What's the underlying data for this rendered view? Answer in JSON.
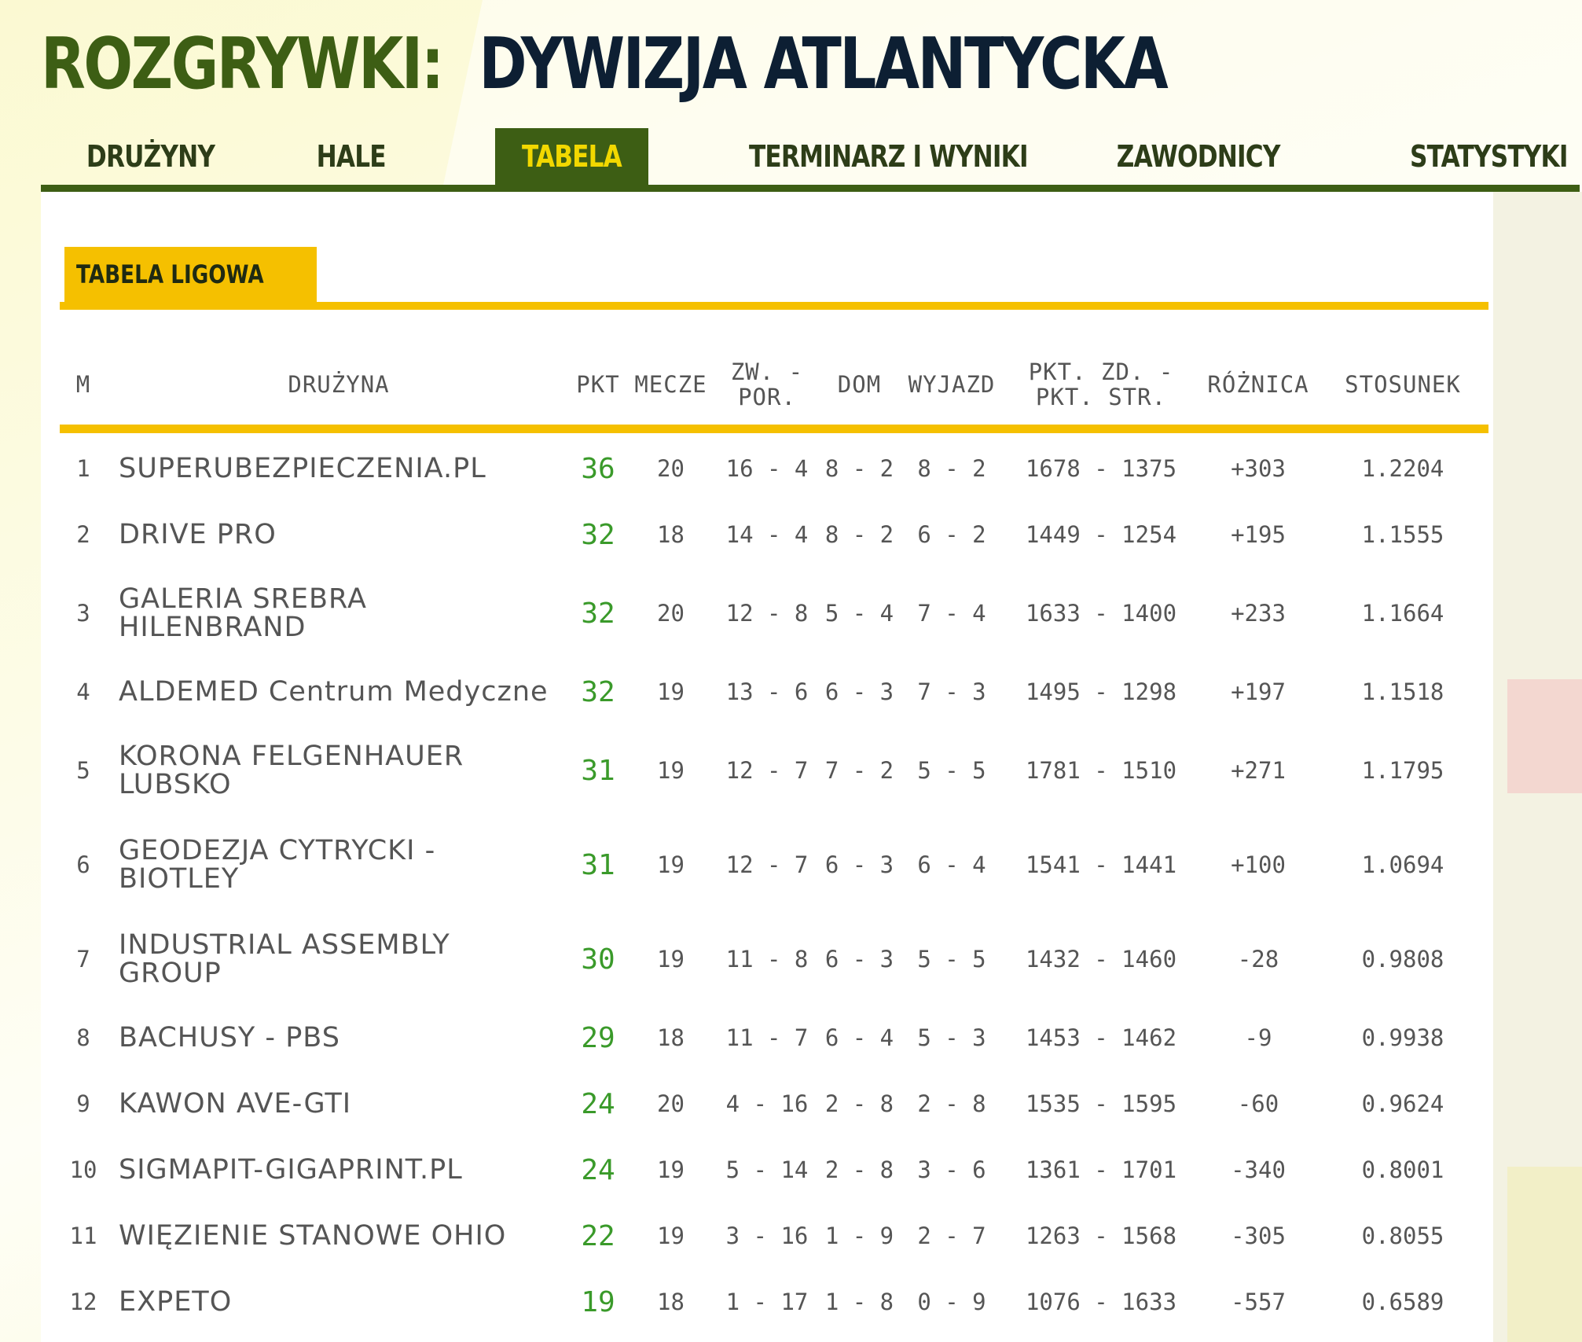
{
  "title": {
    "prefix": "ROZGRYWKI:",
    "main": "DYWIZJA ATLANTYCKA"
  },
  "tabs": [
    {
      "label": "DRUŻYNY"
    },
    {
      "label": "HALE"
    },
    {
      "label": "TABELA",
      "active": true
    },
    {
      "label": "TERMINARZ I WYNIKI"
    },
    {
      "label": "ZAWODNICY"
    },
    {
      "label": "STATYSTYKI"
    }
  ],
  "section": {
    "label": "TABELA LIGOWA"
  },
  "table": {
    "headers": {
      "pos": "M",
      "team": "DRUŻYNA",
      "pts": "PKT",
      "games": "MECZE",
      "wl": "ZW. - POR.",
      "home": "DOM",
      "away": "WYJAZD",
      "points_for_against": "PKT. ZD. - PKT. STR.",
      "diff": "RÓŻNICA",
      "ratio": "STOSUNEK"
    },
    "rows": [
      {
        "pos": "1",
        "team": "SUPERUBEZPIECZENIA.PL",
        "pts": "36",
        "games": "20",
        "wl": "16 - 4",
        "home": "8 - 2",
        "away": "8 - 2",
        "pfpa": "1678 - 1375",
        "diff": "+303",
        "ratio": "1.2204"
      },
      {
        "pos": "2",
        "team": "DRIVE PRO",
        "pts": "32",
        "games": "18",
        "wl": "14 - 4",
        "home": "8 - 2",
        "away": "6 - 2",
        "pfpa": "1449 - 1254",
        "diff": "+195",
        "ratio": "1.1555"
      },
      {
        "pos": "3",
        "team": "GALERIA SREBRA HILENBRAND",
        "pts": "32",
        "games": "20",
        "wl": "12 - 8",
        "home": "5 - 4",
        "away": "7 - 4",
        "pfpa": "1633 - 1400",
        "diff": "+233",
        "ratio": "1.1664"
      },
      {
        "pos": "4",
        "team": "ALDEMED Centrum Medyczne",
        "pts": "32",
        "games": "19",
        "wl": "13 - 6",
        "home": "6 - 3",
        "away": "7 - 3",
        "pfpa": "1495 - 1298",
        "diff": "+197",
        "ratio": "1.1518"
      },
      {
        "pos": "5",
        "team": "KORONA FELGENHAUER LUBSKO",
        "pts": "31",
        "games": "19",
        "wl": "12 - 7",
        "home": "7 - 2",
        "away": "5 - 5",
        "pfpa": "1781 - 1510",
        "diff": "+271",
        "ratio": "1.1795"
      },
      {
        "pos": "6",
        "team": "GEODEZJA CYTRYCKI - BIOTLEY",
        "pts": "31",
        "games": "19",
        "wl": "12 - 7",
        "home": "6 - 3",
        "away": "6 - 4",
        "pfpa": "1541 - 1441",
        "diff": "+100",
        "ratio": "1.0694"
      },
      {
        "pos": "7",
        "team": "INDUSTRIAL ASSEMBLY GROUP",
        "pts": "30",
        "games": "19",
        "wl": "11 - 8",
        "home": "6 - 3",
        "away": "5 - 5",
        "pfpa": "1432 - 1460",
        "diff": "-28",
        "ratio": "0.9808"
      },
      {
        "pos": "8",
        "team": "BACHUSY - PBS",
        "pts": "29",
        "games": "18",
        "wl": "11 - 7",
        "home": "6 - 4",
        "away": "5 - 3",
        "pfpa": "1453 - 1462",
        "diff": "-9",
        "ratio": "0.9938"
      },
      {
        "pos": "9",
        "team": "KAWON AVE-GTI",
        "pts": "24",
        "games": "20",
        "wl": "4 - 16",
        "home": "2 - 8",
        "away": "2 - 8",
        "pfpa": "1535 - 1595",
        "diff": "-60",
        "ratio": "0.9624"
      },
      {
        "pos": "10",
        "team": "SIGMAPIT-GIGAPRINT.PL",
        "pts": "24",
        "games": "19",
        "wl": "5 - 14",
        "home": "2 - 8",
        "away": "3 - 6",
        "pfpa": "1361 - 1701",
        "diff": "-340",
        "ratio": "0.8001"
      },
      {
        "pos": "11",
        "team": "WIĘZIENIE STANOWE OHIO",
        "pts": "22",
        "games": "19",
        "wl": "3 - 16",
        "home": "1 - 9",
        "away": "2 - 7",
        "pfpa": "1263 - 1568",
        "diff": "-305",
        "ratio": "0.8055"
      },
      {
        "pos": "12",
        "team": "EXPETO",
        "pts": "19",
        "games": "18",
        "wl": "1 - 17",
        "home": "1 - 8",
        "away": "0 - 9",
        "pfpa": "1076 - 1633",
        "diff": "-557",
        "ratio": "0.6589"
      }
    ]
  },
  "colors": {
    "brand_green": "#3d5e14",
    "title_dark": "#0d1f33",
    "accent_yellow": "#f5c000",
    "tab_active_text": "#f2d800",
    "points_green": "#3a9a2a"
  }
}
